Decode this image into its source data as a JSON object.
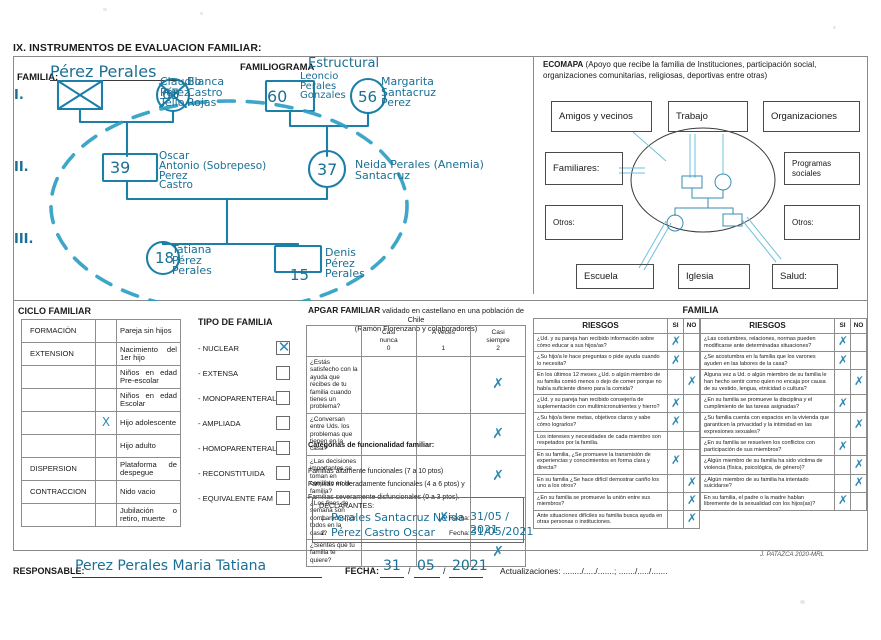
{
  "document": {
    "title": "IX. INSTRUMENTOS  DE EVALUACION FAMILIAR:",
    "credit": "J. PATAZCA 2020-MRL"
  },
  "familiograma": {
    "familia_label": "FAMILIA:",
    "familia_value": "Pérez Perales",
    "title": "FAMILIOGRAMA",
    "title_hand": "Estructural",
    "generations": [
      "I.",
      "II.",
      "III."
    ],
    "people": [
      {
        "shape": "square",
        "age": "",
        "name": "Claudio\nPérez\nTello",
        "deceased": true,
        "generation": 1
      },
      {
        "shape": "circle",
        "age": "65",
        "name": "Blanca\nCastro\nRojas",
        "deceased": true,
        "generation": 1
      },
      {
        "shape": "square",
        "age": "60",
        "name": "Leoncio\nPerales\nGonzales",
        "deceased": false,
        "generation": 1
      },
      {
        "shape": "circle",
        "age": "56",
        "name": "Margarita\nSantacruz\nPerez",
        "deceased": false,
        "generation": 1
      },
      {
        "shape": "square",
        "age": "39",
        "name": "Oscar\nAntonio (Sobrepeso)\nPerez\nCastro",
        "deceased": false,
        "generation": 2
      },
      {
        "shape": "circle",
        "age": "37",
        "name": "Neida Perales (Anemia)\nSantacruz",
        "deceased": false,
        "generation": 2
      },
      {
        "shape": "circle",
        "age": "18",
        "name": "Tatiana\nPérez\nPerales",
        "deceased": false,
        "generation": 3
      },
      {
        "shape": "square",
        "age": "15",
        "name": "Denis\nPérez\nPerales",
        "deceased": false,
        "generation": 3
      }
    ]
  },
  "ecomapa": {
    "title": "ECOMAPA",
    "subtitle": "(Apoyo que recibe la familia de Instituciones, participación social, organizaciones comunitarias, religiosas, deportivas entre otras)",
    "boxes": [
      {
        "label": "Amigos y vecinos"
      },
      {
        "label": "Trabajo"
      },
      {
        "label": "Organizaciones"
      },
      {
        "label": "Familiares:"
      },
      {
        "label": "Programas\nsociales"
      },
      {
        "label": "Otros:"
      },
      {
        "label": "Otros:"
      },
      {
        "label": "Escuela"
      },
      {
        "label": "Iglesia"
      },
      {
        "label": "Salud:"
      }
    ]
  },
  "ciclo_familiar": {
    "title": "CICLO FAMILIAR",
    "rows": [
      {
        "category": "FORMACIÓN",
        "mark": "",
        "description": "Pareja sin hijos"
      },
      {
        "category": "EXTENSION",
        "mark": "",
        "description": "Nacimiento del 1er hijo"
      },
      {
        "category": "",
        "mark": "",
        "description": "Niños en edad Pre-escolar"
      },
      {
        "category": "",
        "mark": "",
        "description": "Niños en edad Escolar"
      },
      {
        "category": "",
        "mark": "X",
        "description": "Hijo adolescente"
      },
      {
        "category": "",
        "mark": "",
        "description": "Hijo adulto"
      },
      {
        "category": "DISPERSION",
        "mark": "",
        "description": "Plataforma de despegue"
      },
      {
        "category": "CONTRACCION",
        "mark": "",
        "description": "Nido vacio"
      },
      {
        "category": "",
        "mark": "",
        "description": "Jubilación o retiro, muerte"
      }
    ]
  },
  "tipo_familia": {
    "title": "TIPO DE FAMILIA",
    "options": [
      {
        "label": "- NUCLEAR",
        "checked": true
      },
      {
        "label": "- EXTENSA",
        "checked": false
      },
      {
        "label": "- MONOPARENTERAL",
        "checked": false
      },
      {
        "label": "- AMPLIADA",
        "checked": false
      },
      {
        "label": "- HOMOPARENTERAL",
        "checked": false
      },
      {
        "label": "- RECONSTITUIDA",
        "checked": false
      },
      {
        "label": "- EQUIVALENTE FAM",
        "checked": false
      }
    ]
  },
  "apgar": {
    "title": "APGAR FAMILIAR",
    "title_rest": " validado en castellano en una población de Chile",
    "subtitle": "(Ramón Florenzano y colaboradores)",
    "columns": [
      "",
      "Casi nunca\n0",
      "A veces\n1",
      "Casi siempre\n2"
    ],
    "col_headers": [
      {
        "l1": "Casi",
        "l2": "nunca",
        "l3": "0"
      },
      {
        "l1": "A veces",
        "l2": "",
        "l3": "1"
      },
      {
        "l1": "Casi",
        "l2": "siempre",
        "l3": "2"
      }
    ],
    "rows": [
      {
        "question": "¿Estás satisfecho con la ayuda que recibes de tu familia cuando tienes un problema?",
        "answer": 2
      },
      {
        "question": "¿Conversan entre Uds. los problemas que tienen en la casa?",
        "answer": 2
      },
      {
        "question": "¿Las decisiones importantes se toman en conjunto en la familia?",
        "answer": 2
      },
      {
        "question": "¿Los fines de semana son compartidos por todos en la casa?",
        "answer": 1
      },
      {
        "question": "¿Sientes que tu familia te quiere?",
        "answer": 2
      }
    ],
    "categories_title": "Categorias de funcionalidad familiar:",
    "categories": [
      "Familias altamente funcionales (7 a 10 ptos)",
      "Familias moderadamente funcionales (4 a 6 ptos) y",
      "Familias severamente disfuncionales (0 a 3 ptos)."
    ],
    "declarantes_title": "DECLARANTES:",
    "declarantes": [
      {
        "n": "1.",
        "name": "Perales Santacruz Neida",
        "fecha_label": "Fecha:",
        "fecha": "31/05 / 2021"
      },
      {
        "n": "2.",
        "name": "Pérez Castro Oscar",
        "fecha_label": "Fecha:",
        "fecha": "31/05/2021"
      }
    ]
  },
  "familia_riesgos": {
    "title": "FAMILIA",
    "headers": {
      "riesgos": "RIESGOS",
      "si": "SI",
      "no": "NO"
    },
    "left_rows": [
      {
        "question": "¿Ud. y su pareja han recibido información sobre cómo educar a sus hijos/as?",
        "answer": "SI"
      },
      {
        "question": "¿Su hijo/a le hace preguntas o pide ayuda cuando lo necesita?",
        "answer": "SI"
      },
      {
        "question": "En los últimos 12 meses ¿Ud. o algún miembro de su familia comió menos o dejo de comer porque no había suficiente dinero para la comida?",
        "answer": "NO"
      },
      {
        "question": "¿Ud. y su pareja han recibido consejería de suplementación con multimicronutrientes y hierro?",
        "answer": "SI"
      },
      {
        "question": "¿Su hijo/a tiene metas, objetivos claros y sabe cómo lograrlos?",
        "answer": "SI"
      },
      {
        "question": "Los intereses y necesidades de cada miembro son respetados por la familia.",
        "answer": ""
      },
      {
        "question": "En su familia, ¿Se promueve la transmisión de experiencias y conocimientos en forma clara y directa?",
        "answer": "SI"
      },
      {
        "question": "En su familia ¿Se hace difícil demostrar cariño los uno a los otros?",
        "answer": "NO"
      },
      {
        "question": "¿En su familia se promueve la unión entre sus miembros?",
        "answer": "NO"
      },
      {
        "question": "Ante situaciones difíciles su familia busca ayuda en otras personas o instituciones.",
        "answer": "NO"
      }
    ],
    "right_rows": [
      {
        "question": "¿Las costumbres, relaciones, normas pueden modificarse ante determinadas situaciones?",
        "answer": "SI"
      },
      {
        "question": "¿Se acostumbra en la familia que los varones ayuden en las labores de la casa?",
        "answer": "SI"
      },
      {
        "question": "Alguna vez a Ud. o algún miembro de su familia le han hecho sentir como quien no encaja por causa de su vestido, lengua, etnicidad o cultura?",
        "answer": "NO"
      },
      {
        "question": "¿En su familia se promueve la disciplina y el cumplimiento de las tareas asignadas?",
        "answer": "SI"
      },
      {
        "question": "¿Su familia cuenta con espacios en la vivienda que garanticen la privacidad y la intimidad en las expresiones sexuales?",
        "answer": "NO"
      },
      {
        "question": "¿En su familia se resuelven los conflictos con participación de sus miembros?",
        "answer": "SI"
      },
      {
        "question": "¿Algún miembro de su familia ha sido víctima de violencia (física, psicológica, de género)?",
        "answer": "NO"
      },
      {
        "question": "¿Algún miembro de su familia ha intentado suicidarse?",
        "answer": "NO"
      },
      {
        "question": "En su familia, el padre o la madre hablan libremente de la sexualidad con los hijos(as)?",
        "answer": "SI"
      }
    ]
  },
  "footer": {
    "responsable_label": "RESPONSABLE:",
    "responsable_value": "Perez Perales Maria Tatiana",
    "fecha_label": "FECHA:",
    "fecha_dia": "31",
    "fecha_mes": "05",
    "fecha_anio": "2021",
    "actualizaciones": "Actualizaciones: ......../...../.......; ......./...../......."
  }
}
